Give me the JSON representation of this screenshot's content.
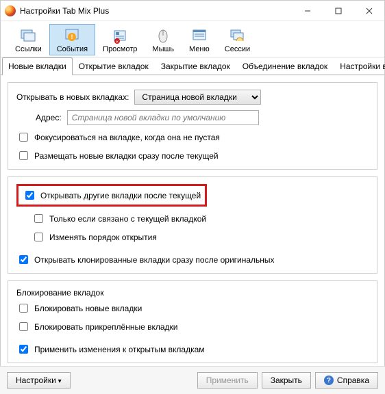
{
  "window": {
    "title": "Настройки Tab Mix Plus"
  },
  "toolbar": {
    "items": [
      {
        "label": "Ссылки"
      },
      {
        "label": "События"
      },
      {
        "label": "Просмотр"
      },
      {
        "label": "Мышь"
      },
      {
        "label": "Меню"
      },
      {
        "label": "Сессии"
      }
    ]
  },
  "tabs": {
    "items": [
      {
        "label": "Новые вкладки"
      },
      {
        "label": "Открытие вкладок"
      },
      {
        "label": "Закрытие вкладок"
      },
      {
        "label": "Объединение вкладок"
      },
      {
        "label": "Настройки вкладок"
      }
    ]
  },
  "group1": {
    "open_in_label": "Открывать в новых вкладках:",
    "open_in_value": "Страница новой вкладки",
    "address_label": "Адрес:",
    "address_placeholder": "Страница новой вкладки по умолчанию",
    "focus_label": "Фокусироваться на вкладке, когда она не пустая",
    "place_after_current_label": "Размещать новые вкладки сразу после текущей"
  },
  "group2": {
    "open_other_after_current_label": "Открывать другие вкладки после текущей",
    "only_related_label": "Только если связано с текущей вкладкой",
    "change_order_label": "Изменять порядок открытия",
    "open_cloned_label": "Открывать клонированные вкладки сразу после оригинальных"
  },
  "group3": {
    "title": "Блокирование вкладок",
    "block_new_label": "Блокировать новые вкладки",
    "block_pinned_label": "Блокировать прикреплённые вкладки",
    "apply_to_open_label": "Применить изменения к открытым вкладкам"
  },
  "footer": {
    "settings_label": "Настройки",
    "apply_label": "Применить",
    "close_label": "Закрыть",
    "help_label": "Справка"
  }
}
